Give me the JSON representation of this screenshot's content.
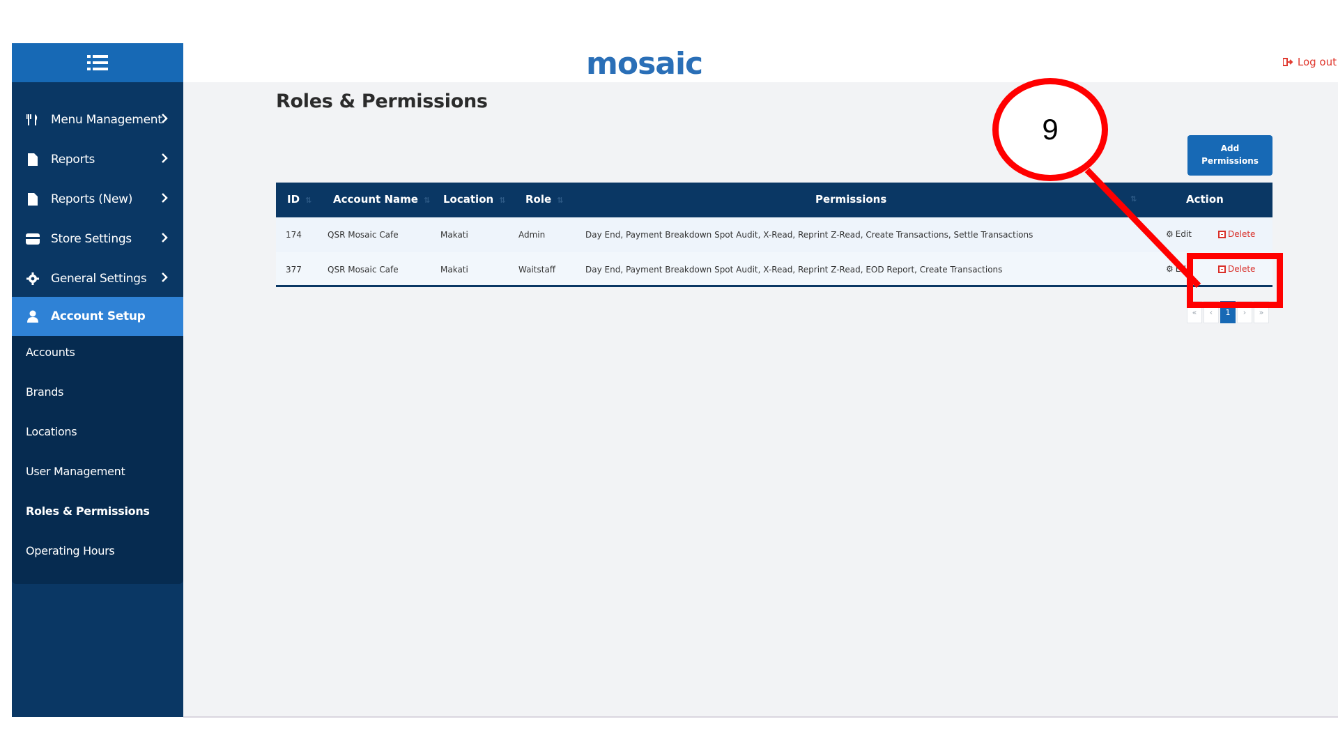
{
  "brand": {
    "logo_text": "mosaic",
    "accent": "#1769b5",
    "sidebar_bg": "#0a3764",
    "danger": "#d9302a"
  },
  "header": {
    "logout_label": "Log out",
    "logout_icon": "sign-out-icon"
  },
  "sidebar": {
    "toggle_icon": "list-icon",
    "items": [
      {
        "label": "Menu Management",
        "icon": "utensils-icon"
      },
      {
        "label": "Reports",
        "icon": "file-icon"
      },
      {
        "label": "Reports (New)",
        "icon": "file-icon"
      },
      {
        "label": "Store Settings",
        "icon": "store-icon"
      },
      {
        "label": "General Settings",
        "icon": "gear-icon"
      },
      {
        "label": "Account Setup",
        "icon": "user-icon",
        "active": true
      }
    ],
    "sub_items": [
      {
        "label": "Accounts"
      },
      {
        "label": "Brands"
      },
      {
        "label": "Locations"
      },
      {
        "label": "User Management"
      },
      {
        "label": "Roles & Permissions",
        "current": true
      },
      {
        "label": "Operating Hours"
      }
    ]
  },
  "main": {
    "title": "Roles & Permissions",
    "add_button_line1": "Add",
    "add_button_line2": "Permissions"
  },
  "table": {
    "columns": [
      "ID",
      "Account Name",
      "Location",
      "Role",
      "Permissions",
      "Action"
    ],
    "rows": [
      {
        "id": "174",
        "account": "QSR Mosaic Cafe",
        "location": "Makati",
        "role": "Admin",
        "permissions": "Day End, Payment Breakdown Spot Audit, X-Read, Reprint Z-Read, Create Transactions, Settle Transactions"
      },
      {
        "id": "377",
        "account": "QSR Mosaic Cafe",
        "location": "Makati",
        "role": "Waitstaff",
        "permissions": "Day End, Payment Breakdown Spot Audit, X-Read, Reprint Z-Read, EOD Report, Create Transactions"
      }
    ],
    "edit_label": "Edit",
    "delete_label": "Delete"
  },
  "pagination": {
    "first": "«",
    "prev": "‹",
    "current": "1",
    "next": "›",
    "last": "»"
  },
  "annotation": {
    "number": "9"
  }
}
